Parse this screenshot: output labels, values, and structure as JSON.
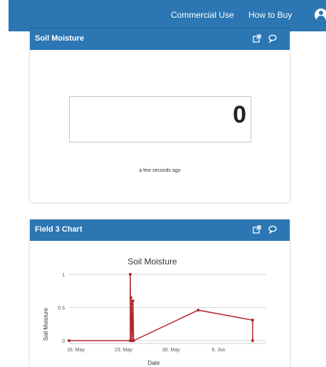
{
  "nav": {
    "links": [
      "Commercial Use",
      "How to Buy"
    ]
  },
  "widget1": {
    "title": "Soil Moisture",
    "value": "0",
    "timestamp": "a few seconds ago"
  },
  "widget2": {
    "title": "Field 3 Chart"
  },
  "icons": {
    "external": "external-link-icon",
    "comment": "comment-icon",
    "user": "user-icon"
  },
  "colors": {
    "header": "#2b76b3",
    "series": "#b3282d"
  },
  "chart_data": {
    "type": "line",
    "title": "Soil Moisture",
    "xlabel": "Date",
    "ylabel": "Soil Moisture",
    "x_ticks": [
      "16. May",
      "23. May",
      "30. May",
      "6. Jun"
    ],
    "x_tick_days": [
      16,
      23,
      30,
      37
    ],
    "y_ticks": [
      "0",
      "0.5",
      "1"
    ],
    "ylim": [
      0,
      1
    ],
    "xlim_days": [
      15,
      44
    ],
    "series": [
      {
        "x_days": [
          15,
          24,
          24,
          24.1,
          24.1,
          24.2,
          24.2,
          24.3,
          24.4,
          24.5,
          34,
          42,
          42
        ],
        "values": [
          0,
          0,
          1,
          0,
          0.65,
          0.55,
          0.4,
          0,
          0.6,
          0,
          0.46,
          0.31,
          0
        ]
      }
    ],
    "grid": true
  }
}
